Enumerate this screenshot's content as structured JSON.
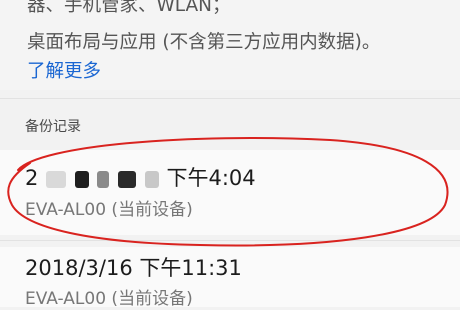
{
  "description": {
    "line1": "器、手机管家、WLAN；",
    "line2": "桌面布局与应用 (不含第三方应用内数据)。",
    "learn_more": "了解更多"
  },
  "section_header": "备份记录",
  "records": [
    {
      "date_prefix": "2",
      "time": "下午4:04",
      "device": "EVA-AL00 (当前设备)"
    },
    {
      "title": "2018/3/16 下午11:31",
      "device": "EVA-AL00 (当前设备)"
    }
  ],
  "colors": {
    "link": "#1a66d2",
    "annotation": "#d9231f"
  }
}
